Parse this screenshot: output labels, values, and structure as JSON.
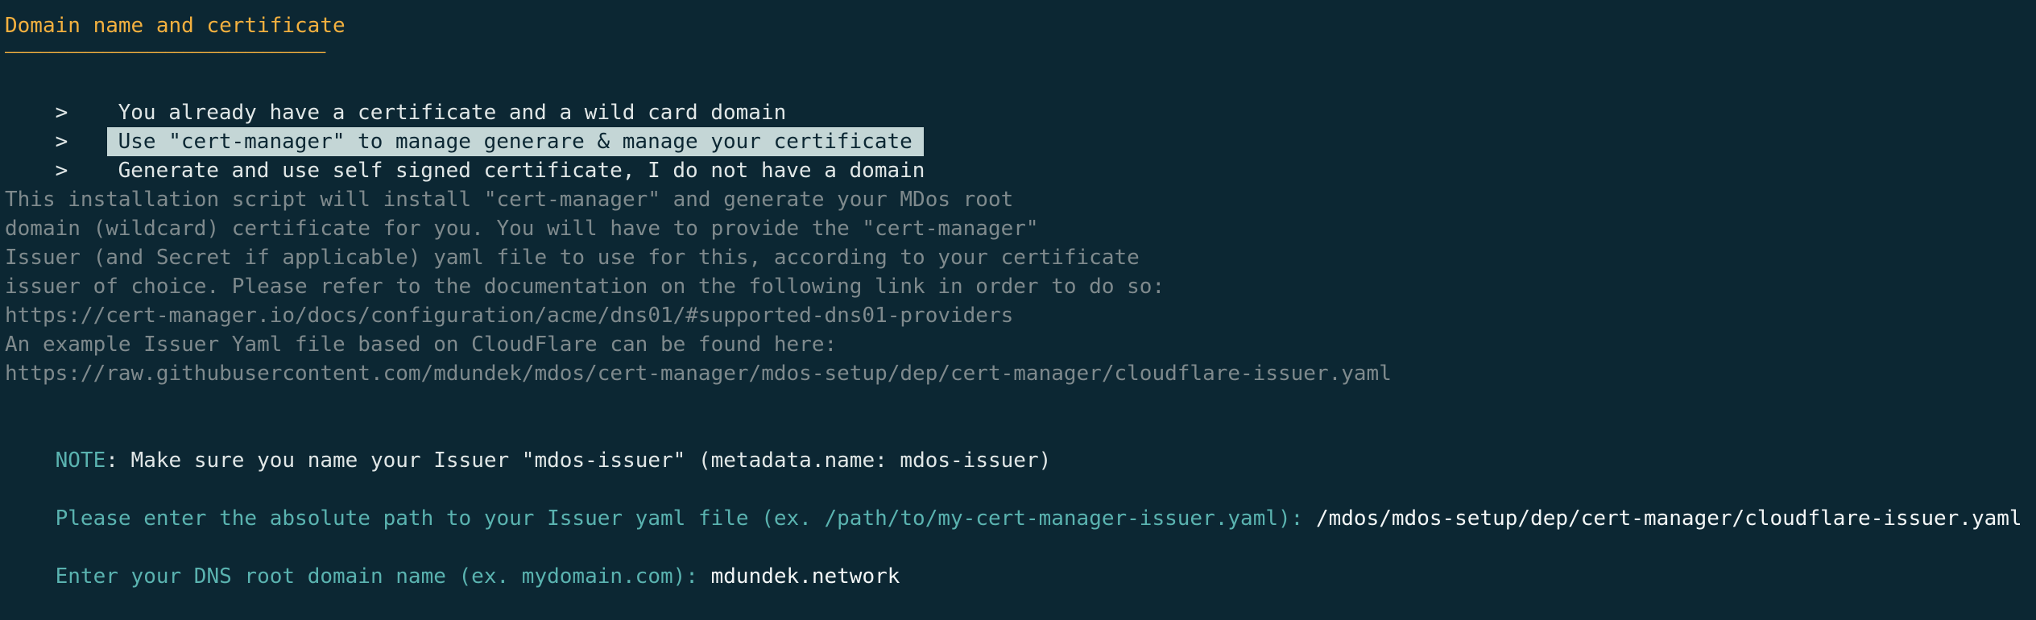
{
  "section": {
    "title": "Domain name and certificate",
    "rule": "————————————————————————————————————"
  },
  "options": [
    {
      "caret": ">",
      "label": "You already have a certificate and a wild card domain",
      "selected": false
    },
    {
      "caret": ">",
      "label": "Use \"cert-manager\" to manage generare & manage your certificate",
      "selected": true
    },
    {
      "caret": ">",
      "label": "Generate and use self signed certificate, I do not have a domain",
      "selected": false
    }
  ],
  "info_lines": [
    "This installation script will install \"cert-manager\" and generate your MDos root",
    "domain (wildcard) certificate for you. You will have to provide the \"cert-manager\"",
    "Issuer (and Secret if applicable) yaml file to use for this, according to your certificate",
    "issuer of choice. Please refer to the documentation on the following link in order to do so:",
    "https://cert-manager.io/docs/configuration/acme/dns01/#supported-dns01-providers",
    "An example Issuer Yaml file based on CloudFlare can be found here:",
    "https://raw.githubusercontent.com/mdundek/mdos/cert-manager/mdos-setup/dep/cert-manager/cloudflare-issuer.yaml"
  ],
  "note": {
    "label": "NOTE",
    "text": ": Make sure you name your Issuer \"mdos-issuer\" (metadata.name: mdos-issuer)"
  },
  "prompts": [
    {
      "question": "Please enter the absolute path to your Issuer yaml file (ex. /path/to/my-cert-manager-issuer.yaml): ",
      "answer": "/mdos/mdos-setup/dep/cert-manager/cloudflare-issuer.yaml"
    },
    {
      "question": "Enter your DNS root domain name (ex. mydomain.com): ",
      "answer": "mdundek.network"
    }
  ],
  "colors": {
    "background": "#0c2733",
    "title": "#f3b03f",
    "selected_bg": "#c4d6d6",
    "dim_text": "#7f8a8d",
    "accent": "#5ab3b0",
    "text": "#e1e7e7"
  }
}
